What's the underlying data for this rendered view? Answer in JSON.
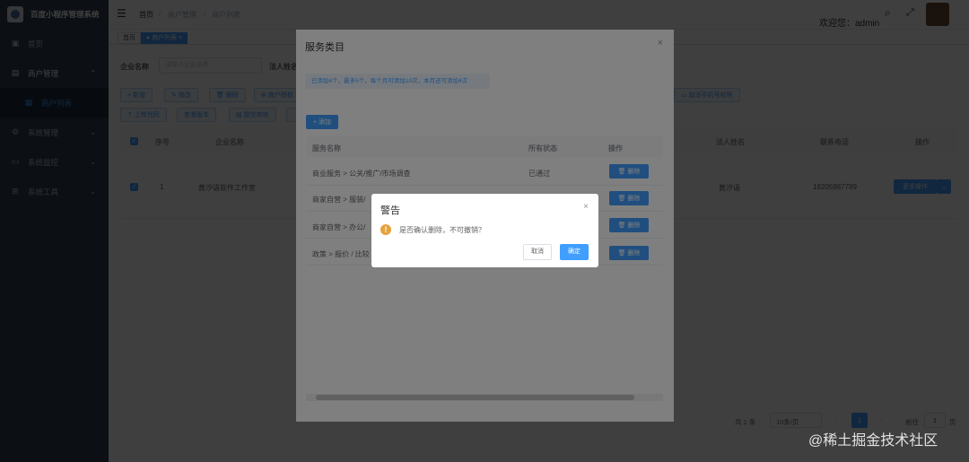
{
  "app": {
    "title": "百度小程序管理系统"
  },
  "sidebar": {
    "items": [
      {
        "label": "首页",
        "icon": "dashboard-icon"
      },
      {
        "label": "商户管理",
        "icon": "shop-icon"
      },
      {
        "label": "商户列表",
        "icon": "list-icon"
      },
      {
        "label": "系统管理",
        "icon": "gear-icon"
      },
      {
        "label": "系统监控",
        "icon": "monitor-icon"
      },
      {
        "label": "系统工具",
        "icon": "tool-icon"
      }
    ]
  },
  "navbar": {
    "breadcrumb": [
      "首页",
      "商户管理",
      "商户列表"
    ],
    "welcome": "欢迎您：admin"
  },
  "tags": [
    "首页",
    "商户列表"
  ],
  "filters": {
    "company_label": "企业名称",
    "company_placeholder": "请输入企业名称",
    "legal_label": "法人姓名"
  },
  "toolbar": {
    "row1": [
      "+ 新增",
      "修改",
      "删除",
      "商户授权"
    ],
    "row2": [
      "上传代码",
      "查看版本",
      "提交审核"
    ],
    "cancel_phone": "取消手机号权限"
  },
  "table": {
    "headers": [
      "序号",
      "企业名称",
      "法人姓名",
      "联系电话",
      "操作"
    ],
    "rows": [
      {
        "index": "1",
        "company": "黄汐语软件工作室",
        "legal": "黄汐语",
        "phone": "18205987789",
        "action": "更多操作"
      }
    ]
  },
  "pagination": {
    "total": "共 1 条",
    "per_page": "10条/页",
    "page": "1",
    "goto": "前往",
    "goto_value": "1",
    "unit": "页"
  },
  "dialog": {
    "title": "服务类目",
    "tip": "已添加4个，最多5个，每个月可添加10次，本月还可添加4次",
    "add_label": "+ 添加",
    "headers": [
      "服务名称",
      "所有状态",
      "操作"
    ],
    "rows": [
      {
        "name": "商业服务 > 公关/推广/市场调查",
        "status": "已通过",
        "action": "删除"
      },
      {
        "name": "商家自营 > 服装/",
        "status": "",
        "action": "删除"
      },
      {
        "name": "商家自营 > 办公/",
        "status": "",
        "action": "删除"
      },
      {
        "name": "政策 > 报价 / 比较",
        "status": "",
        "action": "删除"
      }
    ]
  },
  "alert": {
    "title": "警告",
    "message": "是否确认删除，不可撤销？",
    "cancel": "取消",
    "confirm": "确定"
  },
  "watermark": "@稀土掘金技术社区",
  "colors": {
    "primary": "#409eff",
    "sidebar": "#304156",
    "warning": "#e6a23c"
  }
}
